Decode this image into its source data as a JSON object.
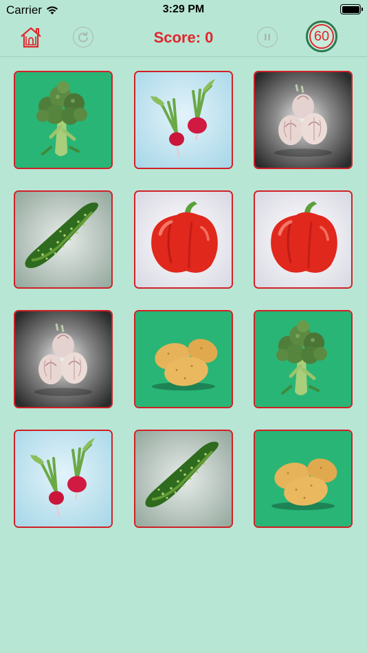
{
  "status_bar": {
    "carrier": "Carrier",
    "time": "3:29 PM"
  },
  "toolbar": {
    "home_icon": "home-icon",
    "restart_icon": "restart-icon",
    "score_label": "Score: 0",
    "pause_icon": "pause-icon",
    "timer_value": "60"
  },
  "colors": {
    "background": "#b8e6d5",
    "accent_red": "#e0262a",
    "card_border": "#d11f25",
    "timer_ring": "#2b7a4f"
  },
  "cards": [
    {
      "item": "broccoli",
      "bg": "green"
    },
    {
      "item": "radish",
      "bg": "lightblue"
    },
    {
      "item": "garlic",
      "bg": "dark"
    },
    {
      "item": "cucumber",
      "bg": "grey"
    },
    {
      "item": "bell-pepper",
      "bg": "white"
    },
    {
      "item": "bell-pepper",
      "bg": "white"
    },
    {
      "item": "garlic",
      "bg": "dark"
    },
    {
      "item": "potato",
      "bg": "green"
    },
    {
      "item": "broccoli",
      "bg": "green"
    },
    {
      "item": "radish",
      "bg": "lightblue"
    },
    {
      "item": "cucumber",
      "bg": "grey"
    },
    {
      "item": "potato",
      "bg": "green"
    }
  ]
}
